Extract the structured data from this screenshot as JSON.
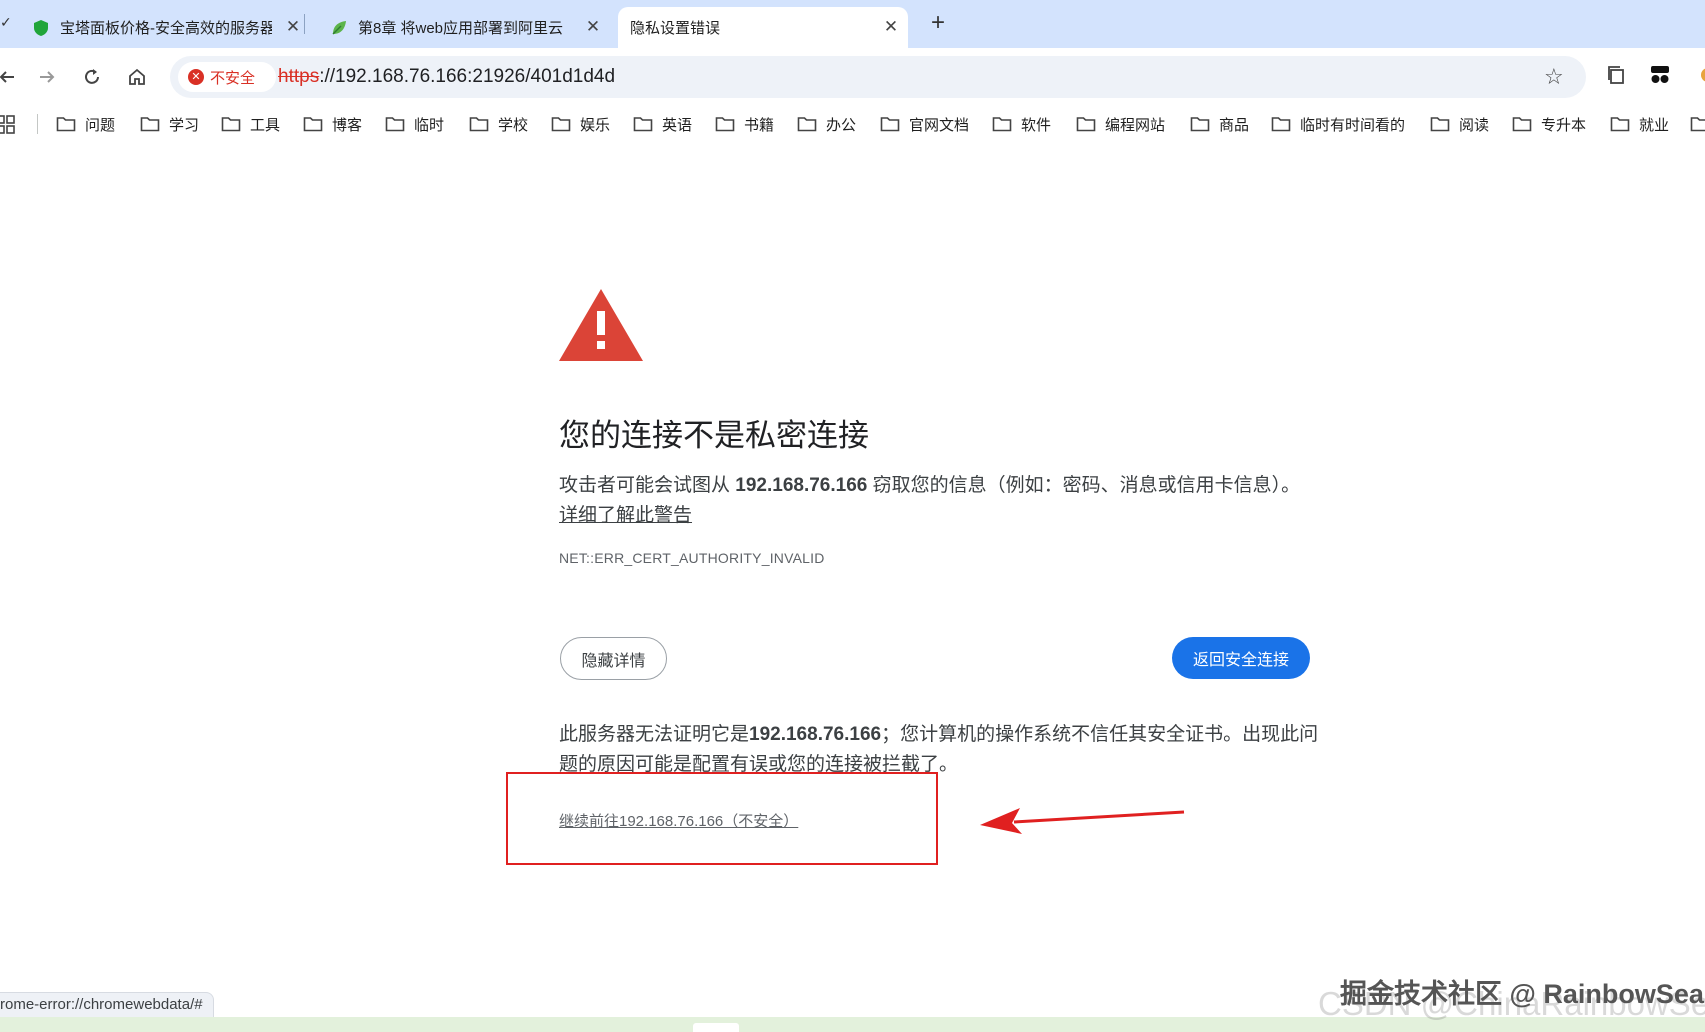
{
  "tabs": [
    {
      "title": "宝塔面板价格-安全高效的服务器",
      "favicon": "shield-icon",
      "close": "✕"
    },
    {
      "title": "第8章 将web应用部署到阿里云",
      "favicon": "leaf-icon",
      "close": "✕"
    },
    {
      "title": "隐私设置错误",
      "favicon": "",
      "close": "✕",
      "active": true
    }
  ],
  "new_tab": "+",
  "address": {
    "security_label": "不安全",
    "scheme": "https",
    "rest": "://192.168.76.166:21926/401d1d4d"
  },
  "bookmarks": [
    "问题",
    "学习",
    "工具",
    "博客",
    "临时",
    "学校",
    "娱乐",
    "英语",
    "书籍",
    "办公",
    "官网文档",
    "软件",
    "编程网站",
    "商品",
    "临时有时间看的",
    "阅读",
    "专升本",
    "就业"
  ],
  "interstitial": {
    "heading": "您的连接不是私密连接",
    "para_prefix": "攻击者可能会试图从 ",
    "host": "192.168.76.166",
    "para_suffix": " 窃取您的信息（例如：密码、消息或信用卡信息）。",
    "learn_more": "详细了解此警告",
    "error_code": "NET::ERR_CERT_AUTHORITY_INVALID",
    "hide_details": "隐藏详情",
    "back_to_safety": "返回安全连接",
    "details_prefix": "此服务器无法证明它是",
    "details_host": "192.168.76.166",
    "details_suffix": "；您计算机的操作系统不信任其安全证书。出现此问题的原因可能是配置有误或您的连接被拦截了。",
    "proceed_link": "继续前往192.168.76.166（不安全）"
  },
  "status_bar": "rome-error://chromewebdata/#",
  "watermark": "掘金技术社区 @ RainbowSea",
  "watermark_faint": "CSDN @ChinaRainbowSea",
  "colors": {
    "tabstrip": "#d3e3fd",
    "danger": "#d93025",
    "primary": "#1a73e8",
    "annotation": "#e02020"
  }
}
